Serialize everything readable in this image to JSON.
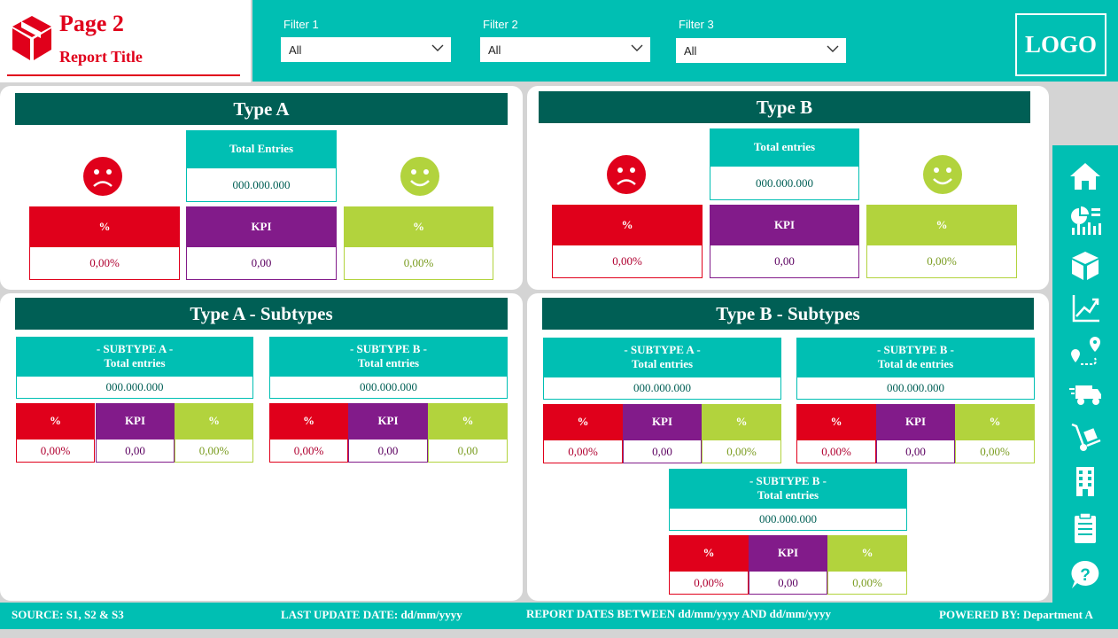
{
  "header": {
    "page": "Page 2",
    "report_title": "Report Title",
    "logo": "LOGO"
  },
  "filters": [
    {
      "label": "Filter 1",
      "value": "All"
    },
    {
      "label": "Filter 2",
      "value": "All"
    },
    {
      "label": "Filter 3",
      "value": "All"
    }
  ],
  "type_a": {
    "title": "Type A",
    "total_label": "Total Entries",
    "total_value": "000.000.000",
    "left_label": "%",
    "left_value": "0,00%",
    "kpi_label": "KPI",
    "kpi_value": "0,00",
    "right_label": "%",
    "right_value": "0,00%"
  },
  "type_b": {
    "title": "Type B",
    "total_label": "Total entries",
    "total_value": "000.000.000",
    "left_label": "%",
    "left_value": "0,00%",
    "kpi_label": "KPI",
    "kpi_value": "0,00",
    "right_label": "%",
    "right_value": "0,00%"
  },
  "type_a_sub": {
    "title": "Type A - Subtypes",
    "cards": [
      {
        "name": "- SUBTYPE A -",
        "total_label": "Total entries",
        "total_value": "000.000.000",
        "left": "0,00%",
        "kpi": "0,00",
        "right": "0,00%"
      },
      {
        "name": "- SUBTYPE B -",
        "total_label": "Total entries",
        "total_value": "000.000.000",
        "left": "0,00%",
        "kpi": "0,00",
        "right": "0,00"
      }
    ]
  },
  "type_b_sub": {
    "title": "Type B - Subtypes",
    "cards": [
      {
        "name": "- SUBTYPE A -",
        "total_label": "Total entries",
        "total_value": "000.000.000",
        "left": "0,00%",
        "kpi": "0,00",
        "right": "0,00%"
      },
      {
        "name": "- SUBTYPE B -",
        "total_label": "Total de entries",
        "total_value": "000.000.000",
        "left": "0,00%",
        "kpi": "0,00",
        "right": "0,00%"
      },
      {
        "name": "- SUBTYPE B -",
        "total_label": "Total entries",
        "total_value": "000.000.000",
        "left": "0,00%",
        "kpi": "0,00",
        "right": "0,00%"
      }
    ]
  },
  "labels": {
    "pct": "%",
    "kpi": "KPI"
  },
  "nav": [
    "home-icon",
    "analytics-icon",
    "package-icon",
    "trend-chart-icon",
    "route-icon",
    "delivery-truck-icon",
    "hand-truck-icon",
    "building-icon",
    "clipboard-icon",
    "help-icon"
  ],
  "footer": {
    "source": "SOURCE: S1, S2 & S3",
    "last_update": "LAST UPDATE DATE:  dd/mm/yyyy",
    "report_dates": "REPORT DATES BETWEEN dd/mm/yyyy AND dd/mm/yyyy",
    "powered": "POWERED BY: Department A"
  },
  "colors": {
    "teal": "#00bfb3",
    "dark_teal": "#005f55",
    "red": "#e0001b",
    "purple": "#821b8a",
    "green": "#b2d33d"
  }
}
